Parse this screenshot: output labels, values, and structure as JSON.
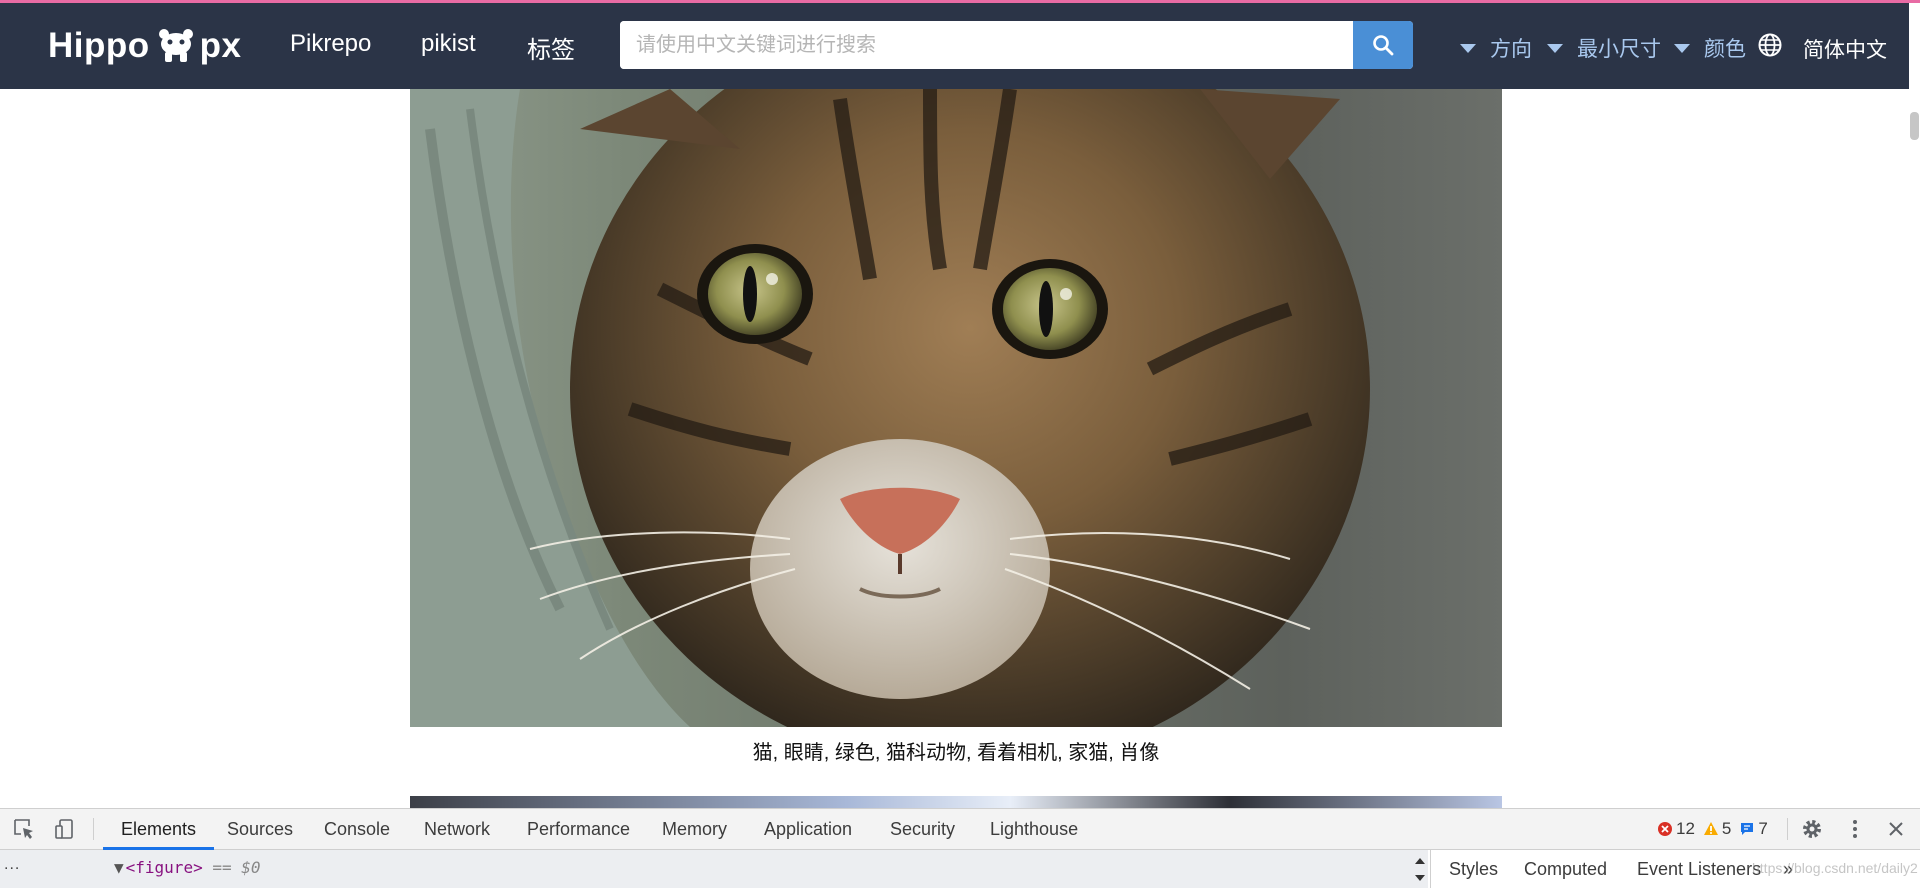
{
  "site": {
    "logo_left": "Hippo",
    "logo_right": "px",
    "nav": [
      "Pikrepo",
      "pikist",
      "标签"
    ],
    "search_placeholder": "请使用中文关键词进行搜索",
    "filters": [
      "方向",
      "最小尺寸",
      "颜色"
    ],
    "language": "简体中文",
    "colors": {
      "navbar": "#2b3447",
      "search_button": "#4a8fd6",
      "filter_text": "#a9c8ee",
      "accent_line": "#e86ba4"
    }
  },
  "content": {
    "photo_caption": "猫, 眼睛, 绿色, 猫科动物, 看着相机, 家猫, 肖像"
  },
  "devtools": {
    "tabs": [
      "Elements",
      "Sources",
      "Console",
      "Network",
      "Performance",
      "Memory",
      "Application",
      "Security",
      "Lighthouse"
    ],
    "active_tab": "Elements",
    "errors": "12",
    "warnings": "5",
    "messages": "7",
    "breadcrumb_dots": "...",
    "selected_node_open": "<figure>",
    "selected_node_ref": "== $0",
    "side_tabs": [
      "Styles",
      "Computed",
      "Event Listeners"
    ],
    "overflow": "»",
    "watermark": "https://blog.csdn.net/daily2"
  }
}
